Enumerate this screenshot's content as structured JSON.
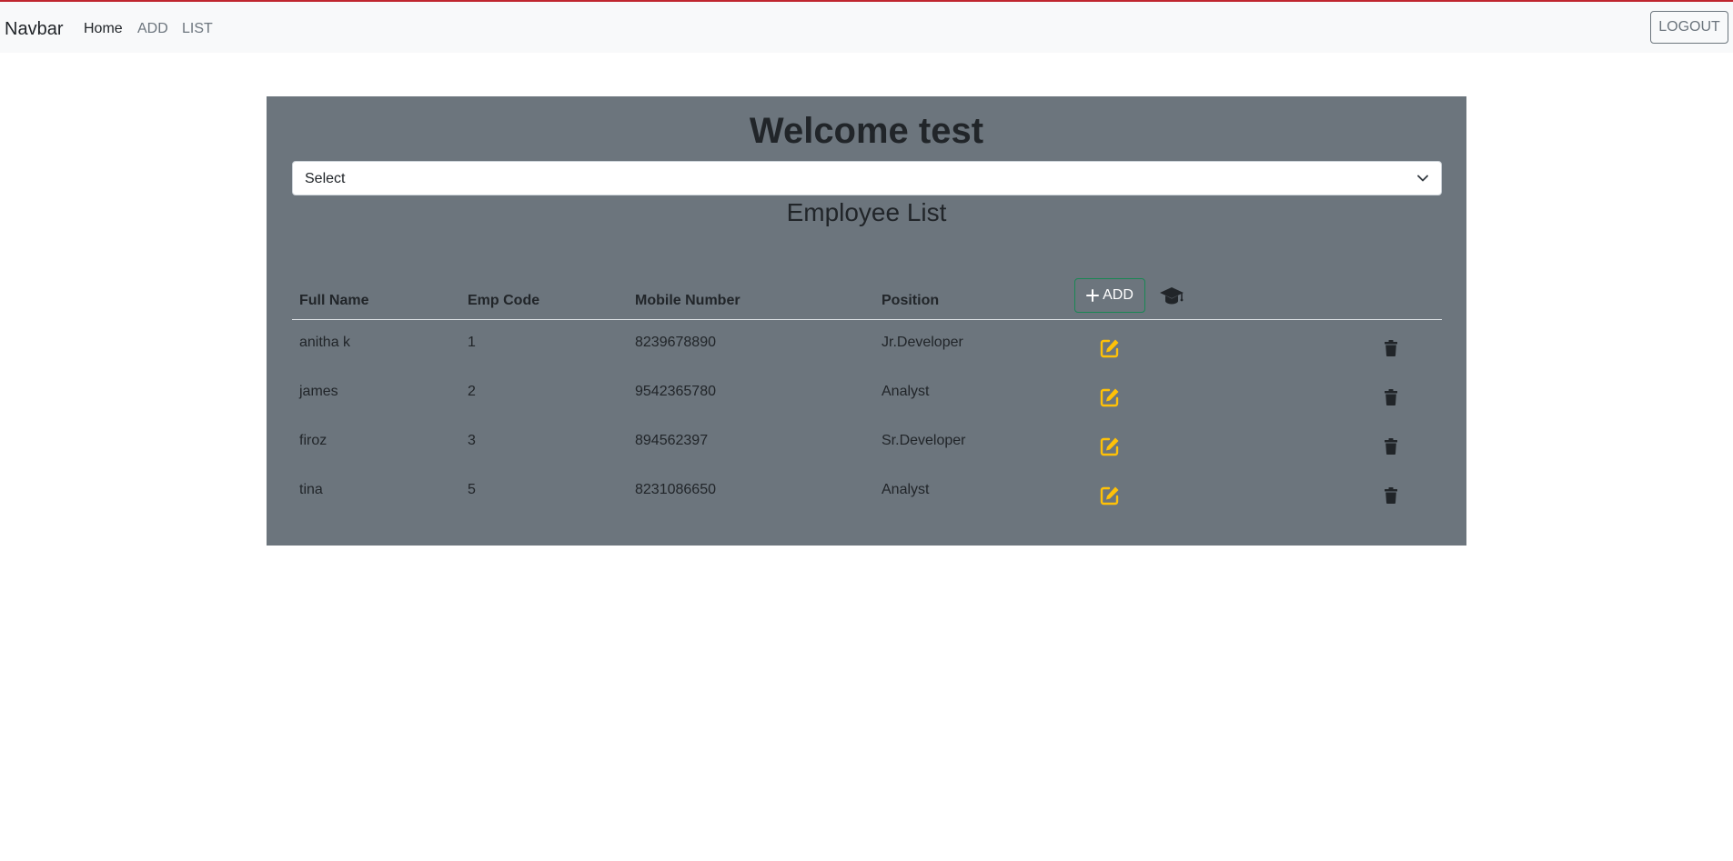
{
  "navbar": {
    "brand": "Navbar",
    "links": [
      {
        "label": "Home",
        "active": true
      },
      {
        "label": "ADD",
        "active": false
      },
      {
        "label": "LIST",
        "active": false
      }
    ],
    "logout_label": "LOGOUT"
  },
  "main": {
    "welcome": "Welcome test",
    "select_value": "Select",
    "list_title": "Employee List",
    "columns": [
      "Full Name",
      "Emp Code",
      "Mobile Number",
      "Position"
    ],
    "add_label": "ADD",
    "rows": [
      {
        "name": "anitha k",
        "code": "1",
        "mobile": "8239678890",
        "position": "Jr.Developer"
      },
      {
        "name": "james",
        "code": "2",
        "mobile": "9542365780",
        "position": "Analyst"
      },
      {
        "name": "firoz",
        "code": "3",
        "mobile": "894562397",
        "position": "Sr.Developer"
      },
      {
        "name": "tina",
        "code": "5",
        "mobile": "8231086650",
        "position": "Analyst"
      }
    ]
  },
  "icons": {
    "add": "plus-icon",
    "cap": "graduation-cap-icon",
    "edit": "edit-icon",
    "delete": "trash-icon",
    "select": "chevron-down-icon"
  },
  "colors": {
    "panel": "#6c757d",
    "navbar": "#f8f9fa",
    "edit": "#ffc107",
    "add_border": "#198754",
    "top_border": "#c0262f"
  }
}
